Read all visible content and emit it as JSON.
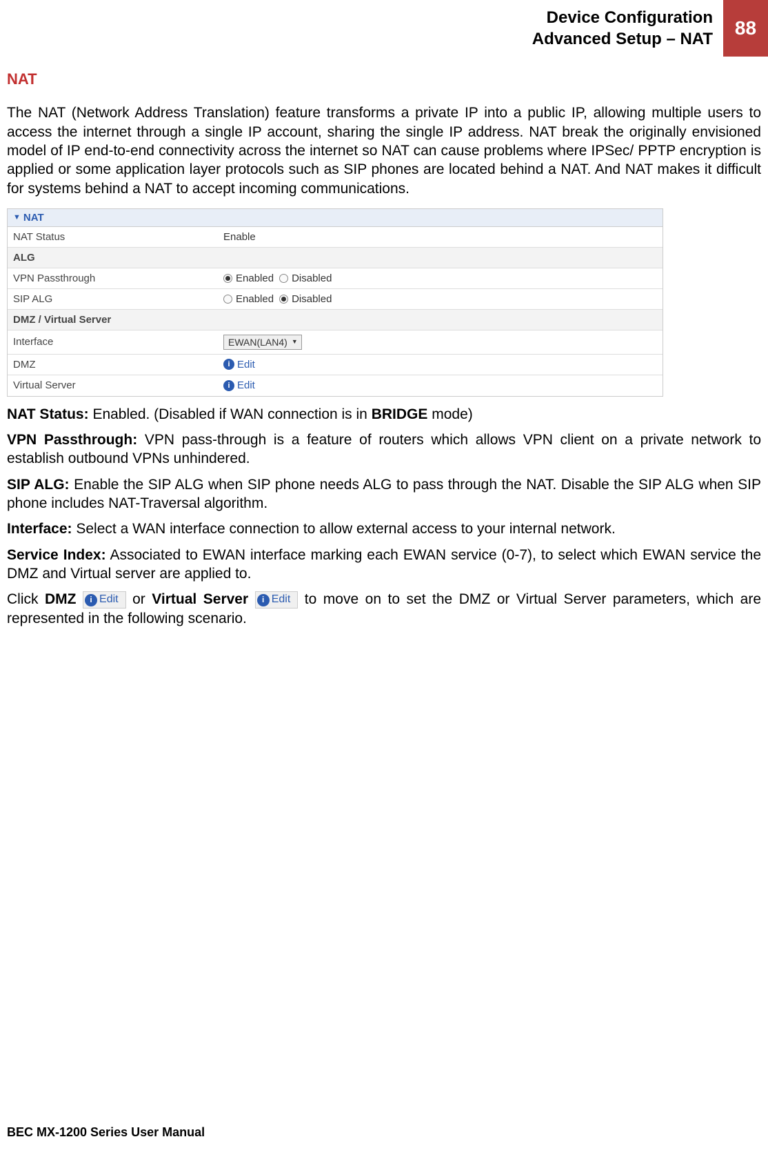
{
  "header": {
    "line1": "Device Configuration",
    "line2": "Advanced Setup – NAT",
    "page_number": "88"
  },
  "section_title": "NAT",
  "intro_paragraph": "The NAT (Network Address Translation) feature transforms a private IP into a public IP, allowing multiple users to access the internet through a single IP account, sharing the single IP address. NAT break the originally envisioned model of IP end-to-end connectivity across the internet so NAT can cause problems where IPSec/ PPTP encryption is applied or some application layer protocols such as SIP phones are located behind a NAT. And NAT makes it difficult for systems behind a NAT to accept incoming communications.",
  "panel": {
    "title": "NAT",
    "nat_status_label": "NAT Status",
    "nat_status_value": "Enable",
    "alg_header": "ALG",
    "vpn_label": "VPN Passthrough",
    "vpn_enabled": "Enabled",
    "vpn_disabled": "Disabled",
    "sip_label": "SIP ALG",
    "sip_enabled": "Enabled",
    "sip_disabled": "Disabled",
    "dmz_vs_header": "DMZ / Virtual Server",
    "interface_label": "Interface",
    "interface_value": "EWAN(LAN4)",
    "dmz_label": "DMZ",
    "vs_label": "Virtual Server",
    "edit_text": "Edit"
  },
  "descriptions": {
    "nat_status_b": "NAT Status:",
    "nat_status_t": " Enabled. (Disabled if WAN connection is in ",
    "nat_status_b2": "BRIDGE",
    "nat_status_t2": " mode)",
    "vpn_b": "VPN Passthrough:",
    "vpn_t": " VPN pass-through is a feature of routers which allows VPN client on a private network to establish outbound VPNs unhindered.",
    "sip_b": "SIP ALG:",
    "sip_t": " Enable the SIP ALG when SIP phone needs ALG to pass through the NAT. Disable the SIP ALG when SIP phone includes NAT-Traversal algorithm.",
    "interface_b": "Interface:",
    "interface_t": " Select a WAN interface connection to allow external access to your internal network.",
    "service_b": "Service Index:",
    "service_t": " Associated to EWAN interface marking each EWAN service (0-7), to select which EWAN service the DMZ and Virtual server are applied to.",
    "click_t1": "Click ",
    "click_b1": "DMZ",
    "click_edit": "Edit",
    "click_t2": " or ",
    "click_b2": "Virtual Server",
    "click_t3": " to move on to set the DMZ or Virtual Server parameters, which are represented in the following scenario."
  },
  "footer": "BEC MX-1200 Series User Manual"
}
